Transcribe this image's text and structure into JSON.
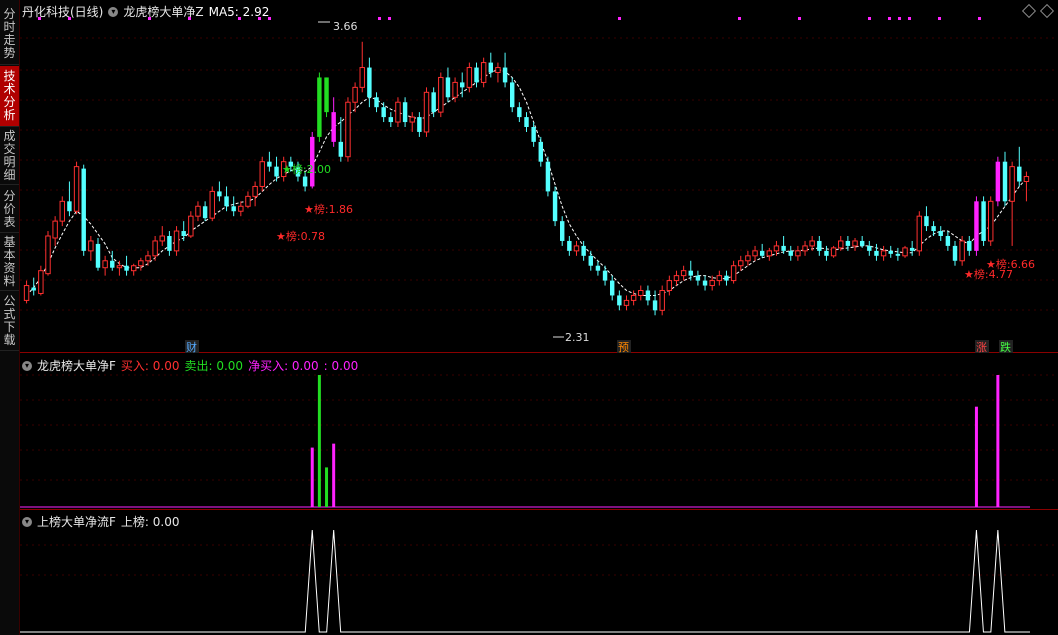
{
  "sidebar": {
    "tabs": [
      {
        "label": "分时走势",
        "active": false
      },
      {
        "label": "技术分析",
        "active": true
      },
      {
        "label": "成交明细",
        "active": false
      },
      {
        "label": "分价表",
        "active": false
      },
      {
        "label": "基本资料",
        "active": false
      },
      {
        "label": "公式下载",
        "active": false
      }
    ]
  },
  "main": {
    "title": "丹化科技(日线)",
    "indicator": "龙虎榜大单净Z",
    "ma_label": "MA5: 2.92",
    "high_label": "3.66",
    "low_label": "2.31",
    "annotations": [
      {
        "text": "★榜:2.00",
        "color": "#22dd22"
      },
      {
        "text": "★榜:1.86",
        "color": "#ff2a2a"
      },
      {
        "text": "★榜:0.78",
        "color": "#ff2a2a"
      },
      {
        "text": "★榜:4.77",
        "color": "#ff2a2a"
      },
      {
        "text": "★榜:6.66",
        "color": "#ff2a2a"
      }
    ],
    "event_markers": [
      {
        "text": "财",
        "color": "#55aaff"
      },
      {
        "text": "预",
        "color": "#ff8800"
      },
      {
        "text": "涨",
        "color": "#ff4444"
      },
      {
        "text": "跌",
        "color": "#44ff44"
      }
    ]
  },
  "pane2": {
    "title": "龙虎榜大单净F",
    "buy": "买入: 0.00",
    "sell": "卖出: 0.00",
    "net": "净买入: 0.00",
    "net2": ": 0.00"
  },
  "pane3": {
    "title": "上榜大单净流F",
    "value": "上榜: 0.00"
  },
  "colors": {
    "up": "#ff3030",
    "down": "#54ffff",
    "magenta": "#ff22ff",
    "green": "#22dd22",
    "ma": "#ffffff",
    "grid": "#6a0000"
  },
  "chart_data": {
    "type": "candlestick",
    "ohlc": [
      [
        1.05,
        1.25,
        1.02,
        1.2
      ],
      [
        1.18,
        1.28,
        1.1,
        1.15
      ],
      [
        1.12,
        1.4,
        1.1,
        1.35
      ],
      [
        1.32,
        1.75,
        1.3,
        1.7
      ],
      [
        1.68,
        1.9,
        1.6,
        1.85
      ],
      [
        1.85,
        2.1,
        1.8,
        2.05
      ],
      [
        2.05,
        2.25,
        1.9,
        1.95
      ],
      [
        1.95,
        2.45,
        1.92,
        2.4
      ],
      [
        2.38,
        2.42,
        1.5,
        1.55
      ],
      [
        1.55,
        1.7,
        1.45,
        1.65
      ],
      [
        1.62,
        1.68,
        1.35,
        1.38
      ],
      [
        1.38,
        1.5,
        1.3,
        1.45
      ],
      [
        1.45,
        1.55,
        1.35,
        1.38
      ],
      [
        1.38,
        1.45,
        1.3,
        1.4
      ],
      [
        1.4,
        1.5,
        1.3,
        1.35
      ],
      [
        1.35,
        1.42,
        1.3,
        1.4
      ],
      [
        1.4,
        1.48,
        1.35,
        1.45
      ],
      [
        1.45,
        1.55,
        1.4,
        1.5
      ],
      [
        1.5,
        1.7,
        1.45,
        1.65
      ],
      [
        1.65,
        1.8,
        1.6,
        1.7
      ],
      [
        1.7,
        1.75,
        1.5,
        1.55
      ],
      [
        1.55,
        1.8,
        1.5,
        1.75
      ],
      [
        1.75,
        1.85,
        1.65,
        1.7
      ],
      [
        1.7,
        1.95,
        1.68,
        1.9
      ],
      [
        1.9,
        2.05,
        1.85,
        2.0
      ],
      [
        2.0,
        2.05,
        1.85,
        1.88
      ],
      [
        1.88,
        2.2,
        1.85,
        2.15
      ],
      [
        2.15,
        2.25,
        2.05,
        2.1
      ],
      [
        2.1,
        2.2,
        1.95,
        2.0
      ],
      [
        2.0,
        2.1,
        1.9,
        1.95
      ],
      [
        1.95,
        2.05,
        1.9,
        2.0
      ],
      [
        2.0,
        2.15,
        1.98,
        2.1
      ],
      [
        2.1,
        2.25,
        2.0,
        2.2
      ],
      [
        2.2,
        2.5,
        2.15,
        2.45
      ],
      [
        2.45,
        2.55,
        2.35,
        2.4
      ],
      [
        2.4,
        2.5,
        2.25,
        2.3
      ],
      [
        2.3,
        2.5,
        2.25,
        2.45
      ],
      [
        2.45,
        2.5,
        2.35,
        2.4
      ],
      [
        2.4,
        2.45,
        2.25,
        2.3
      ],
      [
        2.3,
        2.35,
        2.15,
        2.2
      ],
      [
        2.2,
        2.75,
        2.18,
        2.7
      ],
      [
        2.7,
        3.35,
        2.65,
        3.3
      ],
      [
        3.3,
        3.3,
        2.9,
        2.95
      ],
      [
        2.95,
        3.1,
        2.6,
        2.65
      ],
      [
        2.65,
        2.9,
        2.45,
        2.5
      ],
      [
        2.5,
        3.1,
        2.45,
        3.05
      ],
      [
        3.05,
        3.25,
        2.95,
        3.2
      ],
      [
        3.2,
        3.66,
        3.15,
        3.4
      ],
      [
        3.4,
        3.5,
        3.0,
        3.1
      ],
      [
        3.1,
        3.15,
        2.95,
        3.0
      ],
      [
        3.0,
        3.05,
        2.85,
        2.9
      ],
      [
        2.9,
        2.95,
        2.8,
        2.85
      ],
      [
        2.85,
        3.1,
        2.8,
        3.05
      ],
      [
        3.05,
        3.1,
        2.8,
        2.85
      ],
      [
        2.85,
        2.95,
        2.75,
        2.9
      ],
      [
        2.9,
        2.95,
        2.7,
        2.75
      ],
      [
        2.75,
        3.2,
        2.7,
        3.15
      ],
      [
        3.15,
        3.2,
        2.9,
        2.95
      ],
      [
        2.95,
        3.35,
        2.9,
        3.3
      ],
      [
        3.3,
        3.4,
        3.05,
        3.1
      ],
      [
        3.1,
        3.3,
        3.05,
        3.25
      ],
      [
        3.25,
        3.35,
        3.1,
        3.2
      ],
      [
        3.2,
        3.45,
        3.15,
        3.4
      ],
      [
        3.4,
        3.45,
        3.2,
        3.25
      ],
      [
        3.25,
        3.5,
        3.2,
        3.45
      ],
      [
        3.45,
        3.55,
        3.3,
        3.35
      ],
      [
        3.35,
        3.45,
        3.25,
        3.4
      ],
      [
        3.4,
        3.55,
        3.2,
        3.25
      ],
      [
        3.25,
        3.3,
        2.95,
        3.0
      ],
      [
        3.0,
        3.05,
        2.85,
        2.9
      ],
      [
        2.9,
        2.95,
        2.75,
        2.8
      ],
      [
        2.8,
        2.85,
        2.6,
        2.65
      ],
      [
        2.65,
        2.7,
        2.4,
        2.45
      ],
      [
        2.45,
        2.5,
        2.1,
        2.15
      ],
      [
        2.15,
        2.2,
        1.8,
        1.85
      ],
      [
        1.85,
        1.9,
        1.6,
        1.65
      ],
      [
        1.65,
        1.7,
        1.5,
        1.55
      ],
      [
        1.55,
        1.65,
        1.5,
        1.6
      ],
      [
        1.6,
        1.65,
        1.45,
        1.5
      ],
      [
        1.5,
        1.55,
        1.35,
        1.4
      ],
      [
        1.4,
        1.45,
        1.3,
        1.35
      ],
      [
        1.35,
        1.4,
        1.2,
        1.25
      ],
      [
        1.25,
        1.3,
        1.05,
        1.1
      ],
      [
        1.1,
        1.15,
        0.95,
        1.0
      ],
      [
        1.0,
        1.1,
        0.95,
        1.05
      ],
      [
        1.05,
        1.15,
        1.0,
        1.1
      ],
      [
        1.1,
        1.2,
        1.05,
        1.15
      ],
      [
        1.15,
        1.2,
        1.0,
        1.05
      ],
      [
        1.05,
        1.15,
        0.9,
        0.95
      ],
      [
        0.95,
        1.2,
        0.9,
        1.15
      ],
      [
        1.15,
        1.3,
        1.1,
        1.25
      ],
      [
        1.25,
        1.35,
        1.2,
        1.3
      ],
      [
        1.3,
        1.4,
        1.25,
        1.35
      ],
      [
        1.35,
        1.45,
        1.25,
        1.3
      ],
      [
        1.3,
        1.35,
        1.2,
        1.25
      ],
      [
        1.25,
        1.3,
        1.15,
        1.2
      ],
      [
        1.2,
        1.3,
        1.15,
        1.25
      ],
      [
        1.25,
        1.35,
        1.2,
        1.3
      ],
      [
        1.3,
        1.35,
        1.2,
        1.25
      ],
      [
        1.25,
        1.45,
        1.22,
        1.4
      ],
      [
        1.4,
        1.5,
        1.35,
        1.45
      ],
      [
        1.45,
        1.55,
        1.4,
        1.5
      ],
      [
        1.5,
        1.6,
        1.45,
        1.55
      ],
      [
        1.55,
        1.62,
        1.48,
        1.5
      ],
      [
        1.5,
        1.58,
        1.45,
        1.55
      ],
      [
        1.55,
        1.65,
        1.5,
        1.6
      ],
      [
        1.6,
        1.7,
        1.52,
        1.55
      ],
      [
        1.55,
        1.6,
        1.45,
        1.5
      ],
      [
        1.5,
        1.6,
        1.45,
        1.55
      ],
      [
        1.55,
        1.65,
        1.5,
        1.6
      ],
      [
        1.6,
        1.7,
        1.55,
        1.65
      ],
      [
        1.65,
        1.7,
        1.5,
        1.55
      ],
      [
        1.55,
        1.6,
        1.45,
        1.5
      ],
      [
        1.5,
        1.6,
        1.48,
        1.58
      ],
      [
        1.58,
        1.7,
        1.55,
        1.65
      ],
      [
        1.65,
        1.7,
        1.55,
        1.6
      ],
      [
        1.6,
        1.68,
        1.55,
        1.65
      ],
      [
        1.65,
        1.7,
        1.58,
        1.6
      ],
      [
        1.6,
        1.65,
        1.5,
        1.55
      ],
      [
        1.55,
        1.62,
        1.45,
        1.5
      ],
      [
        1.5,
        1.6,
        1.45,
        1.55
      ],
      [
        1.55,
        1.6,
        1.48,
        1.52
      ],
      [
        1.52,
        1.58,
        1.45,
        1.5
      ],
      [
        1.5,
        1.6,
        1.48,
        1.58
      ],
      [
        1.58,
        1.65,
        1.5,
        1.55
      ],
      [
        1.55,
        1.95,
        1.5,
        1.9
      ],
      [
        1.9,
        2.0,
        1.75,
        1.8
      ],
      [
        1.8,
        1.85,
        1.7,
        1.75
      ],
      [
        1.75,
        1.8,
        1.65,
        1.7
      ],
      [
        1.7,
        1.75,
        1.55,
        1.6
      ],
      [
        1.6,
        1.65,
        1.4,
        1.45
      ],
      [
        1.45,
        1.7,
        1.4,
        1.65
      ],
      [
        1.65,
        1.7,
        1.5,
        1.55
      ],
      [
        1.55,
        2.1,
        1.5,
        2.05
      ],
      [
        2.05,
        2.1,
        1.6,
        1.65
      ],
      [
        1.65,
        2.1,
        1.6,
        2.05
      ],
      [
        2.05,
        2.5,
        2.0,
        2.45
      ],
      [
        2.45,
        2.55,
        2.0,
        2.05
      ],
      [
        2.05,
        2.45,
        1.6,
        2.4
      ],
      [
        2.4,
        2.6,
        2.2,
        2.25
      ],
      [
        2.25,
        2.35,
        2.05,
        2.3
      ]
    ],
    "bar_colors": {
      "40": "#ff22ff",
      "41": "#22dd22",
      "42": "#22dd22",
      "43": "#ff22ff",
      "133": "#ff22ff",
      "136": "#ff22ff"
    },
    "ma5": [
      1.1,
      1.18,
      1.28,
      1.42,
      1.58,
      1.72,
      1.85,
      1.95,
      1.9,
      1.82,
      1.72,
      1.62,
      1.48,
      1.42,
      1.38,
      1.38,
      1.38,
      1.42,
      1.48,
      1.55,
      1.6,
      1.65,
      1.68,
      1.75,
      1.8,
      1.85,
      1.9,
      1.95,
      2.0,
      2.02,
      2.04,
      2.05,
      2.08,
      2.15,
      2.22,
      2.28,
      2.32,
      2.36,
      2.38,
      2.35,
      2.4,
      2.55,
      2.7,
      2.8,
      2.85,
      2.92,
      2.98,
      3.05,
      3.1,
      3.08,
      3.02,
      2.98,
      2.95,
      2.92,
      2.9,
      2.88,
      2.9,
      2.95,
      3.0,
      3.05,
      3.1,
      3.15,
      3.2,
      3.25,
      3.3,
      3.35,
      3.38,
      3.36,
      3.3,
      3.2,
      3.05,
      2.85,
      2.65,
      2.45,
      2.22,
      2.0,
      1.82,
      1.7,
      1.6,
      1.52,
      1.45,
      1.38,
      1.3,
      1.22,
      1.15,
      1.12,
      1.1,
      1.1,
      1.1,
      1.12,
      1.15,
      1.2,
      1.25,
      1.28,
      1.3,
      1.3,
      1.28,
      1.27,
      1.27,
      1.3,
      1.35,
      1.4,
      1.45,
      1.48,
      1.5,
      1.52,
      1.54,
      1.55,
      1.55,
      1.56,
      1.57,
      1.58,
      1.57,
      1.56,
      1.57,
      1.58,
      1.59,
      1.6,
      1.6,
      1.58,
      1.56,
      1.55,
      1.54,
      1.53,
      1.53,
      1.6,
      1.67,
      1.72,
      1.75,
      1.75,
      1.7,
      1.65,
      1.62,
      1.7,
      1.75,
      1.8,
      1.9,
      2.0,
      2.1,
      2.2,
      2.28
    ],
    "ylim": [
      0.6,
      3.9
    ],
    "pane2": {
      "bars": [
        {
          "i": 40,
          "color": "#ff22ff",
          "v": 0.45
        },
        {
          "i": 41,
          "color": "#22dd22",
          "v": 1.0
        },
        {
          "i": 42,
          "color": "#22dd22",
          "v": 0.3
        },
        {
          "i": 43,
          "color": "#ff22ff",
          "v": 0.48
        },
        {
          "i": 133,
          "color": "#ff22ff",
          "v": 0.76
        },
        {
          "i": 136,
          "color": "#ff22ff",
          "v": 1.0
        }
      ]
    },
    "pane3": {
      "peaks": [
        40,
        43,
        133,
        136
      ]
    }
  }
}
